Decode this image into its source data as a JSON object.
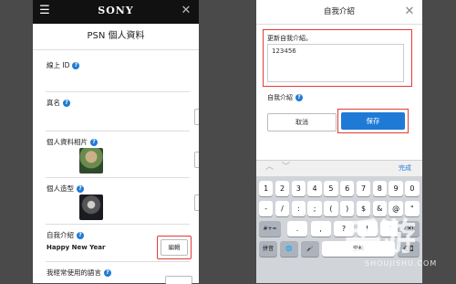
{
  "left": {
    "menu_icon": "☰",
    "brand": "SONY",
    "close_icon": "✕",
    "page_title": "PSN 個人資料",
    "online_id_label": "線上 ID",
    "real_name_label": "真名",
    "profile_photo_label": "個人資料相片",
    "avatar_label": "個人造型",
    "about_me_label": "自我介紹",
    "about_me_value": "Happy New Year",
    "languages_label": "我經常使用的語言",
    "edit_label": "編輯",
    "help_glyph": "?"
  },
  "right": {
    "title": "自我介紹",
    "close_icon": "✕",
    "field_label": "更新自我介紹。",
    "field_value": "123456",
    "about_me_label": "自我介紹",
    "help_glyph": "?",
    "cancel_label": "取消",
    "save_label": "保存",
    "up_arrow": "︿",
    "down_arrow": "﹀",
    "done_label": "完成",
    "keyboard": {
      "row1": [
        "1",
        "2",
        "3",
        "4",
        "5",
        "6",
        "7",
        "8",
        "9",
        "0"
      ],
      "row2": [
        "-",
        "/",
        ":",
        ";",
        "(",
        ")",
        "$",
        "&",
        "@",
        "\""
      ],
      "row3_left": "#+=",
      "row3": [
        ".",
        ",",
        "?",
        "!",
        "'"
      ],
      "row3_right": "⌫",
      "row4": [
        "拼音",
        "🌐",
        "🎤",
        "空格",
        "⌫"
      ]
    },
    "accent_color": "#1f7ad6"
  },
  "watermark": {
    "logo_text": "手游",
    "site_text": "SHOUJISHU.COM"
  }
}
